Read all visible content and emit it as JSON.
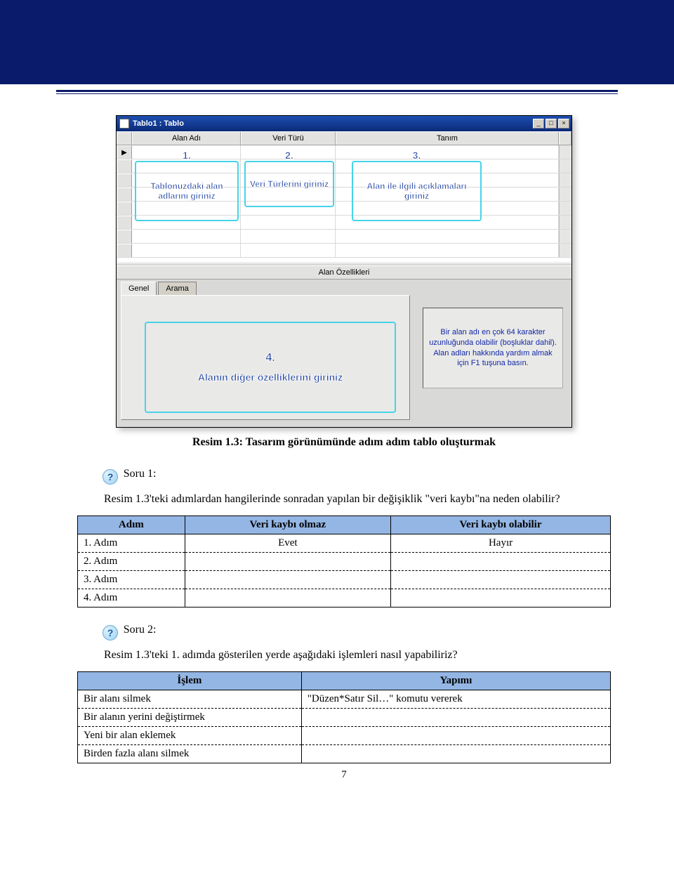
{
  "page_number": "7",
  "figure": {
    "window_title": "Tablo1 : Tablo",
    "col_headers": {
      "alan_adi": "Alan Adı",
      "veri_turu": "Veri Türü",
      "tanim": "Tanım"
    },
    "section_title": "Alan Özellikleri",
    "tabs": {
      "genel": "Genel",
      "arama": "Arama"
    },
    "help_text": "Bir alan adı en çok 64 karakter uzunluğunda olabilir (boşluklar dahil). Alan adları hakkında yardım almak için F1 tuşuna basın.",
    "callouts": {
      "c1": {
        "n": "1.",
        "txt": "Tablonuzdaki alan adlarını giriniz"
      },
      "c2": {
        "n": "2.",
        "txt": "Veri Türlerini giriniz"
      },
      "c3": {
        "n": "3.",
        "txt": "Alan ile ilgili açıklamaları giriniz"
      },
      "c4": {
        "n": "4.",
        "txt": "Alanın diğer özelliklerini giriniz"
      }
    },
    "winbtns": {
      "min": "_",
      "max": "□",
      "close": "×"
    }
  },
  "caption": "Resim 1.3: Tasarım görünümünde adım adım tablo oluşturmak",
  "q_icon": "?",
  "soru1": {
    "label": "Soru 1:",
    "text": "Resim 1.3'teki adımlardan hangilerinde sonradan yapılan bir değişiklik \"veri kaybı\"na neden olabilir?"
  },
  "soru2": {
    "label": "Soru 2:",
    "text": "Resim 1.3'teki 1. adımda gösterilen yerde aşağıdaki işlemleri nasıl yapabiliriz?"
  },
  "table1": {
    "headers": {
      "h1": "Adım",
      "h2": "Veri kaybı olmaz",
      "h3": "Veri kaybı olabilir"
    },
    "rows": [
      {
        "c1": "1. Adım",
        "c2": "Evet",
        "c3": "Hayır"
      },
      {
        "c1": "2. Adım",
        "c2": "",
        "c3": ""
      },
      {
        "c1": "3. Adım",
        "c2": "",
        "c3": ""
      },
      {
        "c1": "4. Adım",
        "c2": "",
        "c3": ""
      }
    ]
  },
  "table2": {
    "headers": {
      "h1": "İşlem",
      "h2": "Yapımı"
    },
    "rows": [
      {
        "c1": "Bir alanı silmek",
        "c2": "\"Düzen*Satır Sil…\" komutu vererek"
      },
      {
        "c1": "Bir alanın yerini değiştirmek",
        "c2": ""
      },
      {
        "c1": "Yeni bir alan eklemek",
        "c2": ""
      },
      {
        "c1": "Birden fazla alanı silmek",
        "c2": ""
      }
    ]
  }
}
